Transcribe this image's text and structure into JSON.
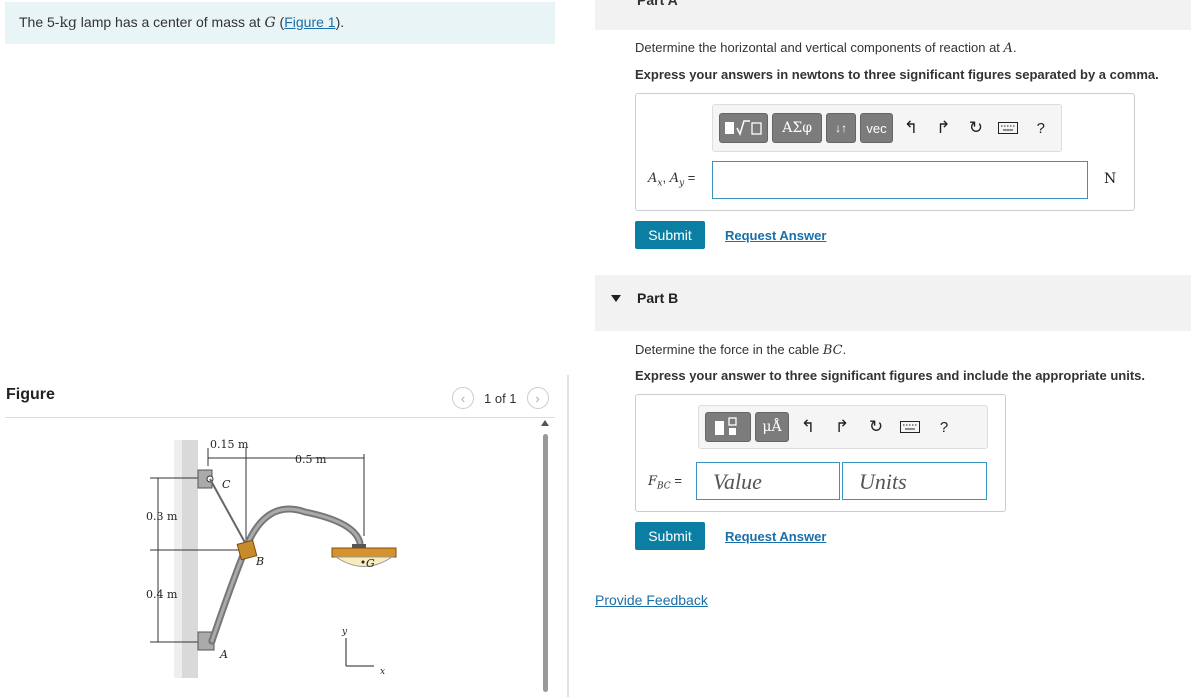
{
  "problem": {
    "text_before": "The 5-",
    "mass_unit": "kg",
    "text_mid": " lamp has a center of mass at ",
    "mass_point": "G",
    "link_open": " (",
    "figure_link": "Figure 1",
    "link_close": ")."
  },
  "figure_panel": {
    "title": "Figure",
    "page_indicator": "1 of 1",
    "prev_icon": "chevron-left-icon",
    "next_icon": "chevron-right-icon",
    "labels": {
      "dim_top": "0.15 m",
      "dim_right": "0.5 m",
      "dim_left_upper": "0.3 m",
      "dim_left_lower": "0.4 m",
      "point_c": "C",
      "point_b": "B",
      "point_a": "A",
      "point_g": "G",
      "axis_y": "y",
      "axis_x": "x"
    }
  },
  "part_a": {
    "header_cut": "Part A",
    "question_prefix": "Determine the horizontal and vertical components of reaction at ",
    "question_point": "A",
    "question_suffix": ".",
    "instruction": "Express your answers in newtons to three significant figures separated by a comma.",
    "toolbar": {
      "template_icon": "template-sqrt-icon",
      "greek_label": "ΑΣφ",
      "sort_label": "↓↑",
      "vec_label": "vec",
      "undo_icon": "undo-icon",
      "redo_icon": "redo-icon",
      "reset_icon": "reset-icon",
      "keyboard_icon": "keyboard-icon",
      "help_label": "?"
    },
    "answer_label_ax": "A",
    "answer_label_x": "x",
    "answer_label_sep": ", ",
    "answer_label_ay": "A",
    "answer_label_y": "y",
    "answer_label_eq": " =",
    "unit": "N",
    "submit": "Submit",
    "request_answer": "Request Answer"
  },
  "part_b": {
    "header": "Part B",
    "question_prefix": "Determine the force in the cable ",
    "question_var": "BC",
    "question_suffix": ".",
    "instruction": "Express your answer to three significant figures and include the appropriate units.",
    "toolbar": {
      "template_icon": "template-fraction-icon",
      "units_label": "μÅ",
      "undo_icon": "undo-icon",
      "redo_icon": "redo-icon",
      "reset_icon": "reset-icon",
      "keyboard_icon": "keyboard-icon",
      "help_label": "?"
    },
    "answer_label_f": "F",
    "answer_label_sub": "BC",
    "answer_label_eq": " =",
    "value_placeholder": "Value",
    "units_placeholder": "Units",
    "submit": "Submit",
    "request_answer": "Request Answer"
  },
  "provide_feedback": "Provide Feedback",
  "colors": {
    "accent": "#0b7fa3",
    "link": "#1a6fa8",
    "problem_bg": "#e8f4f6",
    "input_border": "#3a93bd"
  }
}
